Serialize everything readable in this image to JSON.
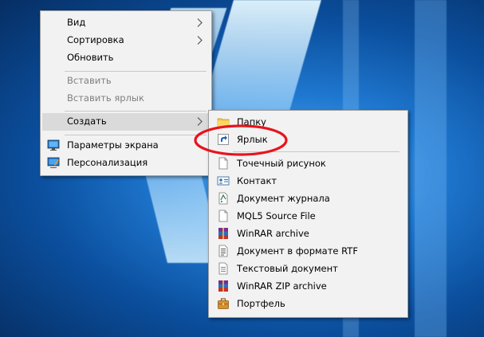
{
  "context_menu": {
    "items": [
      {
        "label": "Вид",
        "has_submenu": true
      },
      {
        "label": "Сортировка",
        "has_submenu": true
      },
      {
        "label": "Обновить"
      },
      {
        "label": "Вставить",
        "disabled": true
      },
      {
        "label": "Вставить ярлык",
        "disabled": true
      },
      {
        "label": "Создать",
        "has_submenu": true,
        "highlighted": true
      },
      {
        "label": "Параметры экрана",
        "icon": "display-settings-icon"
      },
      {
        "label": "Персонализация",
        "icon": "personalization-icon"
      }
    ]
  },
  "create_submenu": {
    "items": [
      {
        "label": "Папку",
        "icon": "folder-icon"
      },
      {
        "label": "Ярлык",
        "icon": "shortcut-icon"
      },
      {
        "label": "Точечный рисунок",
        "icon": "bitmap-file-icon"
      },
      {
        "label": "Контакт",
        "icon": "contact-icon"
      },
      {
        "label": "Документ журнала",
        "icon": "journal-document-icon"
      },
      {
        "label": "MQL5 Source File",
        "icon": "blank-file-icon"
      },
      {
        "label": "WinRAR archive",
        "icon": "winrar-icon"
      },
      {
        "label": "Документ в формате RTF",
        "icon": "rtf-document-icon"
      },
      {
        "label": "Текстовый документ",
        "icon": "text-document-icon"
      },
      {
        "label": "WinRAR ZIP archive",
        "icon": "winrar-zip-icon"
      },
      {
        "label": "Портфель",
        "icon": "briefcase-icon"
      }
    ]
  },
  "annotation": {
    "color": "#e8141c"
  }
}
